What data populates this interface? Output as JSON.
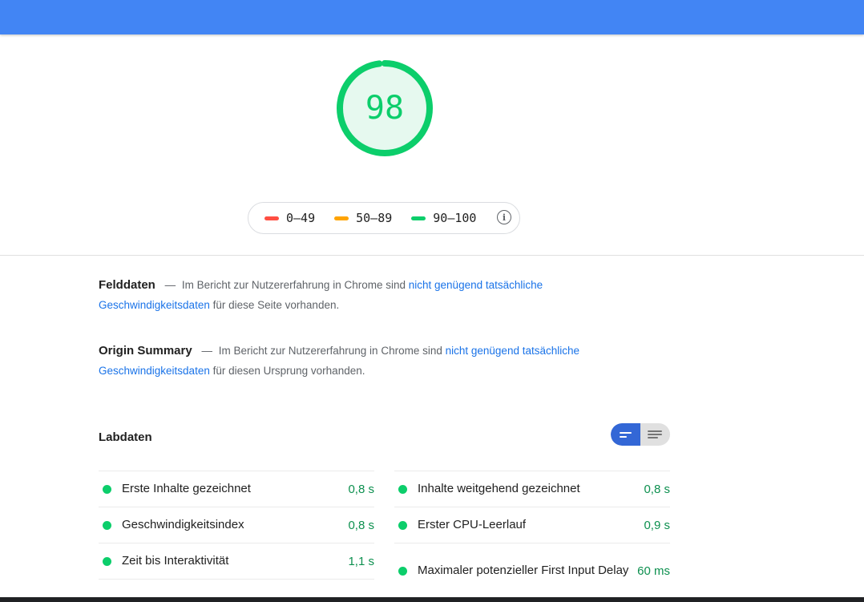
{
  "colors": {
    "brand_bar": "#4285f4",
    "pass": "#0cce6b",
    "average": "#ffa400",
    "fail": "#ff4e42",
    "link": "#1a73e8"
  },
  "score": {
    "value": "98",
    "fraction": 0.98
  },
  "legend": {
    "ranges": [
      {
        "label": "0–49",
        "color": "#ff4e42"
      },
      {
        "label": "50–89",
        "color": "#ffa400"
      },
      {
        "label": "90–100",
        "color": "#0cce6b"
      }
    ],
    "info_icon": "info-icon"
  },
  "field_data": {
    "heading": "Felddaten",
    "dash": "—",
    "text_before": "Im Bericht zur Nutzererfahrung in Chrome sind",
    "link": "nicht genügend tatsächliche Geschwindigkeitsdaten",
    "text_after": "für diese Seite vorhanden."
  },
  "origin_summary": {
    "heading": "Origin Summary",
    "dash": "—",
    "text_before": "Im Bericht zur Nutzererfahrung in Chrome sind",
    "link": "nicht genügend tatsächliche Geschwindigkeitsdaten",
    "text_after": "für diesen Ursprung vorhanden."
  },
  "lab_data": {
    "title": "Labdaten",
    "view_toggle": {
      "selected": "compact-view-icon",
      "other": "list-view-icon"
    },
    "left": [
      {
        "label": "Erste Inhalte gezeichnet",
        "value": "0,8 s"
      },
      {
        "label": "Geschwindigkeitsindex",
        "value": "0,8 s"
      },
      {
        "label": "Zeit bis Interaktivität",
        "value": "1,1 s"
      }
    ],
    "right": [
      {
        "label": "Inhalte weitgehend gezeichnet",
        "value": "0,8 s"
      },
      {
        "label": "Erster CPU-Leerlauf",
        "value": "0,9 s"
      },
      {
        "label": "Maximaler potenzieller First Input Delay",
        "value": "60 ms"
      }
    ]
  }
}
